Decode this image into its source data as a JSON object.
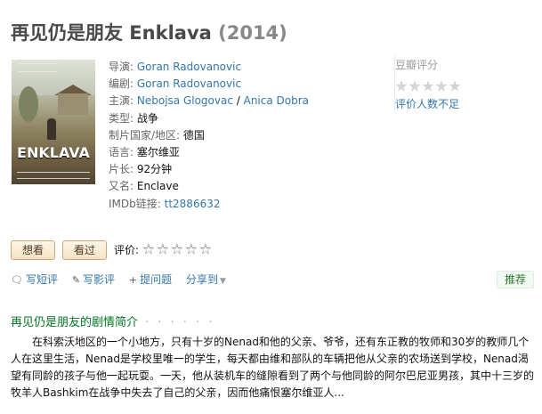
{
  "title": {
    "name": "再见仍是朋友 Enklava",
    "year": "(2014)"
  },
  "poster": {
    "title_text": "ENKLAVA"
  },
  "info": {
    "director_label": "导演:",
    "director": "Goran Radovanovic",
    "writer_label": "编剧:",
    "writer": "Goran Radovanovic",
    "cast_label": "主演:",
    "cast_1": "Nebojsa Glogovac",
    "cast_sep": " / ",
    "cast_2": "Anica Dobra",
    "genre_label": "类型:",
    "genre": "战争",
    "country_label": "制片国家/地区:",
    "country": "德国",
    "language_label": "语言:",
    "language": "塞尔维亚",
    "runtime_label": "片长:",
    "runtime": "92分钟",
    "aka_label": "又名:",
    "aka": "Enclave",
    "imdb_label": "IMDb链接:",
    "imdb": "tt2886632"
  },
  "rating": {
    "title": "豆瓣评分",
    "few_ratings": "评价人数不足",
    "stars_filled": 0
  },
  "buttons": {
    "want": "想看",
    "seen": "看过",
    "rate_label": "评价:"
  },
  "actions": {
    "short_review": "写短评",
    "review": "写影评",
    "question": "提问题",
    "share": "分享到",
    "recommend": "推荐"
  },
  "synopsis": {
    "heading": "再见仍是朋友的剧情简介",
    "dots": "· · · · · ·",
    "text": "在科索沃地区的一个小地方，只有十岁的Nenad和他的父亲、爷爷，还有东正教的牧师和30岁的教师几个人在这里生活，Nenad是学校里唯一的学生，每天都由维和部队的车辆把他从父亲的农场送到学校，Nenad渴望有同龄的孩子与他一起玩耍。一天，他从装机车的缝隙看到了两个与他同龄的阿尔巴尼亚男孩，其中十三岁的牧羊人Bashkim在战争中失去了自己的父亲，因而他痛恨塞尔维亚人..."
  },
  "colors": {
    "link": "#3377aa",
    "green_heading": "#007722",
    "title_gray": "#494949"
  }
}
